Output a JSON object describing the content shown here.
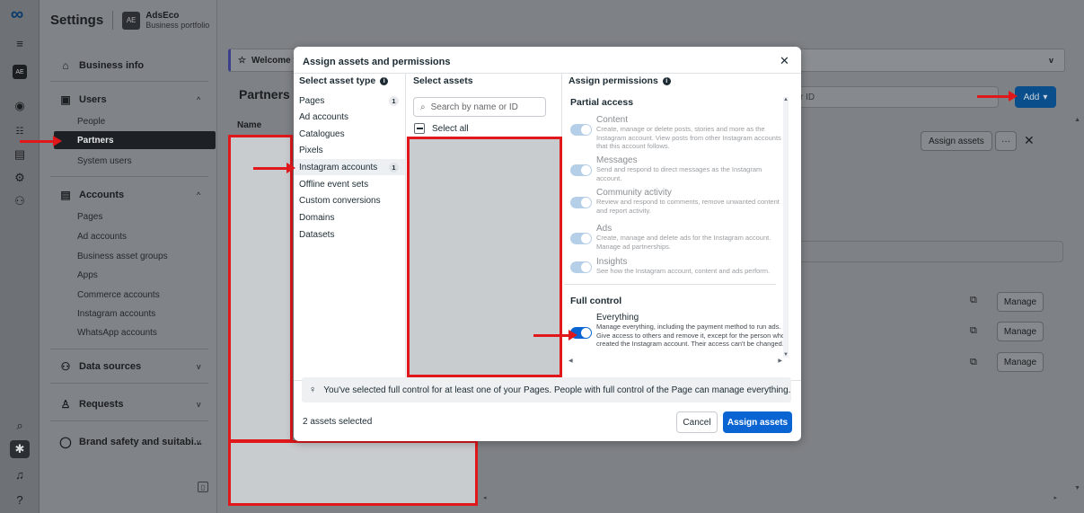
{
  "nav": {
    "settings_title": "Settings",
    "business": {
      "name": "AdsEco",
      "subtitle": "Business portfolio"
    },
    "business_info": "Business info",
    "users": {
      "label": "Users",
      "items": [
        "People",
        "Partners",
        "System users"
      ]
    },
    "accounts": {
      "label": "Accounts",
      "items": [
        "Pages",
        "Ad accounts",
        "Business asset groups",
        "Apps",
        "Commerce accounts",
        "Instagram accounts",
        "WhatsApp accounts"
      ]
    },
    "data_sources": "Data sources",
    "requests": "Requests",
    "brand_safety": "Brand safety and suitabi..."
  },
  "main": {
    "welcome": "Welcome t",
    "title": "Partners (",
    "search_placeholder": "r ID",
    "add_label": "Add",
    "name_col": "Name",
    "assign_assets": "Assign assets",
    "more": "···",
    "manage_label": "Manage"
  },
  "modal": {
    "title": "Assign assets and permissions",
    "col1_head": "Select asset type",
    "col2_head": "Select assets",
    "col3_head": "Assign permissions",
    "asset_types": [
      {
        "label": "Pages",
        "badge": "1"
      },
      {
        "label": "Ad accounts",
        "badge": ""
      },
      {
        "label": "Catalogues",
        "badge": ""
      },
      {
        "label": "Pixels",
        "badge": ""
      },
      {
        "label": "Instagram accounts",
        "badge": "1"
      },
      {
        "label": "Offline event sets",
        "badge": ""
      },
      {
        "label": "Custom conversions",
        "badge": ""
      },
      {
        "label": "Domains",
        "badge": ""
      },
      {
        "label": "Datasets",
        "badge": ""
      }
    ],
    "search_placeholder": "Search by name or ID",
    "select_all": "Select all",
    "partial_access": "Partial access",
    "permissions": [
      {
        "name": "Content",
        "desc": "Create, manage or delete posts, stories and more as the Instagram account. View posts from other Instagram accounts that this account follows."
      },
      {
        "name": "Messages",
        "desc": "Send and respond to direct messages as the Instagram account."
      },
      {
        "name": "Community activity",
        "desc": "Review and respond to comments, remove unwanted content and report activity."
      },
      {
        "name": "Ads",
        "desc": "Create, manage and delete ads for the Instagram account. Manage ad partnerships."
      },
      {
        "name": "Insights",
        "desc": "See how the Instagram account, content and ads perform."
      }
    ],
    "full_control": "Full control",
    "everything": {
      "name": "Everything",
      "desc": "Manage everything, including the payment method to run ads. Give access to others and remove it, except for the person who created the Instagram account. Their access can't be changed."
    },
    "notice": "You've selected full control for at least one of your Pages. People with full control of the Page can manage everything.",
    "selected_count": "2 assets selected",
    "cancel": "Cancel",
    "assign": "Assign assets"
  },
  "colors": {
    "accent": "#0a65d3",
    "annotation_red": "#e0181b",
    "redacted": "#c9cccf"
  }
}
